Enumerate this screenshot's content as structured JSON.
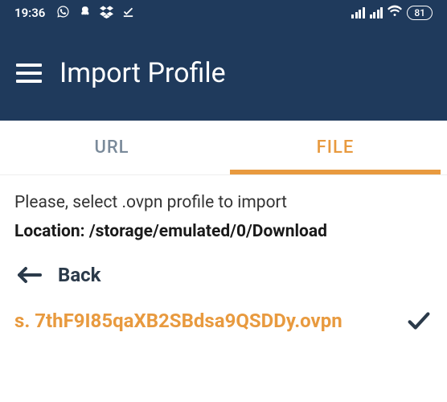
{
  "status": {
    "time": "19:36",
    "battery": "81"
  },
  "app": {
    "title": "Import Profile"
  },
  "tabs": {
    "url": "URL",
    "file": "FILE"
  },
  "content": {
    "instruction": "Please, select .ovpn profile to import",
    "location_label": "Location: /storage/emulated/0/Download",
    "back_label": "Back",
    "file_name": "s. 7thF9I85qaXB2SBdsa9QSDDy.ovpn"
  }
}
